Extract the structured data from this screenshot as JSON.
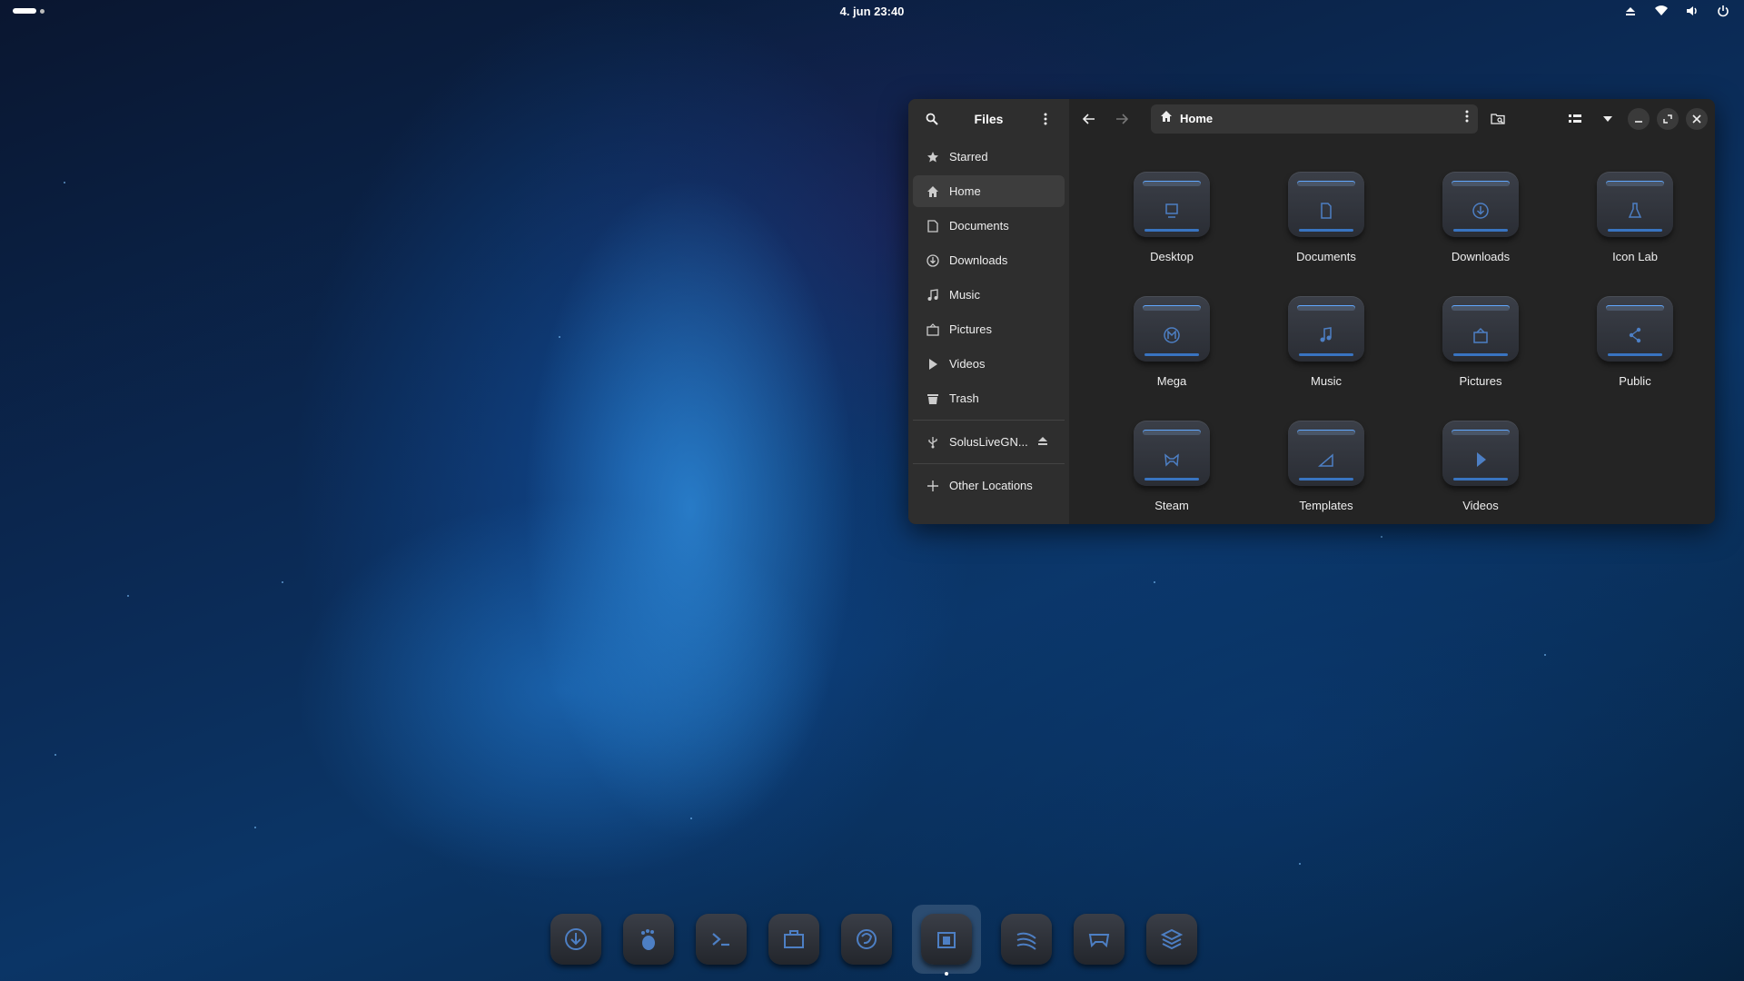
{
  "topbar": {
    "clock": "4. jun  23:40",
    "tray_icons": [
      "eject-icon",
      "wifi-icon",
      "volume-icon",
      "power-icon"
    ]
  },
  "window": {
    "sidebar": {
      "title": "Files",
      "items": [
        {
          "label": "Starred",
          "icon": "star-icon"
        },
        {
          "label": "Home",
          "icon": "home-icon",
          "active": true
        },
        {
          "label": "Documents",
          "icon": "document-icon"
        },
        {
          "label": "Downloads",
          "icon": "download-icon"
        },
        {
          "label": "Music",
          "icon": "music-icon"
        },
        {
          "label": "Pictures",
          "icon": "pictures-icon"
        },
        {
          "label": "Videos",
          "icon": "play-icon"
        },
        {
          "label": "Trash",
          "icon": "trash-icon"
        }
      ],
      "device": {
        "label": "SolusLiveGN...",
        "icon": "usb-icon"
      },
      "other": {
        "label": "Other Locations",
        "icon": "plus-icon"
      }
    },
    "pathbar": {
      "label": "Home"
    },
    "files": [
      {
        "label": "Desktop",
        "icon": "desktop-icon"
      },
      {
        "label": "Documents",
        "icon": "document-icon"
      },
      {
        "label": "Downloads",
        "icon": "download-icon"
      },
      {
        "label": "Icon Lab",
        "icon": "flask-icon"
      },
      {
        "label": "Mega",
        "icon": "mega-icon"
      },
      {
        "label": "Music",
        "icon": "music-icon"
      },
      {
        "label": "Pictures",
        "icon": "pictures-icon"
      },
      {
        "label": "Public",
        "icon": "share-icon"
      },
      {
        "label": "Steam",
        "icon": "steam-icon"
      },
      {
        "label": "Templates",
        "icon": "templates-icon"
      },
      {
        "label": "Videos",
        "icon": "play-icon"
      }
    ]
  },
  "dock": {
    "apps": [
      "software-center-icon",
      "gnome-foot-icon",
      "terminal-icon",
      "briefcase-icon",
      "firefox-icon",
      "files-icon",
      "stream-icon",
      "gamepad-icon",
      "layers-icon"
    ],
    "active_index": 5
  },
  "colors": {
    "accent": "#3d8cf0",
    "window_bg": "#242424",
    "sidebar_bg": "#2e2e2e"
  }
}
